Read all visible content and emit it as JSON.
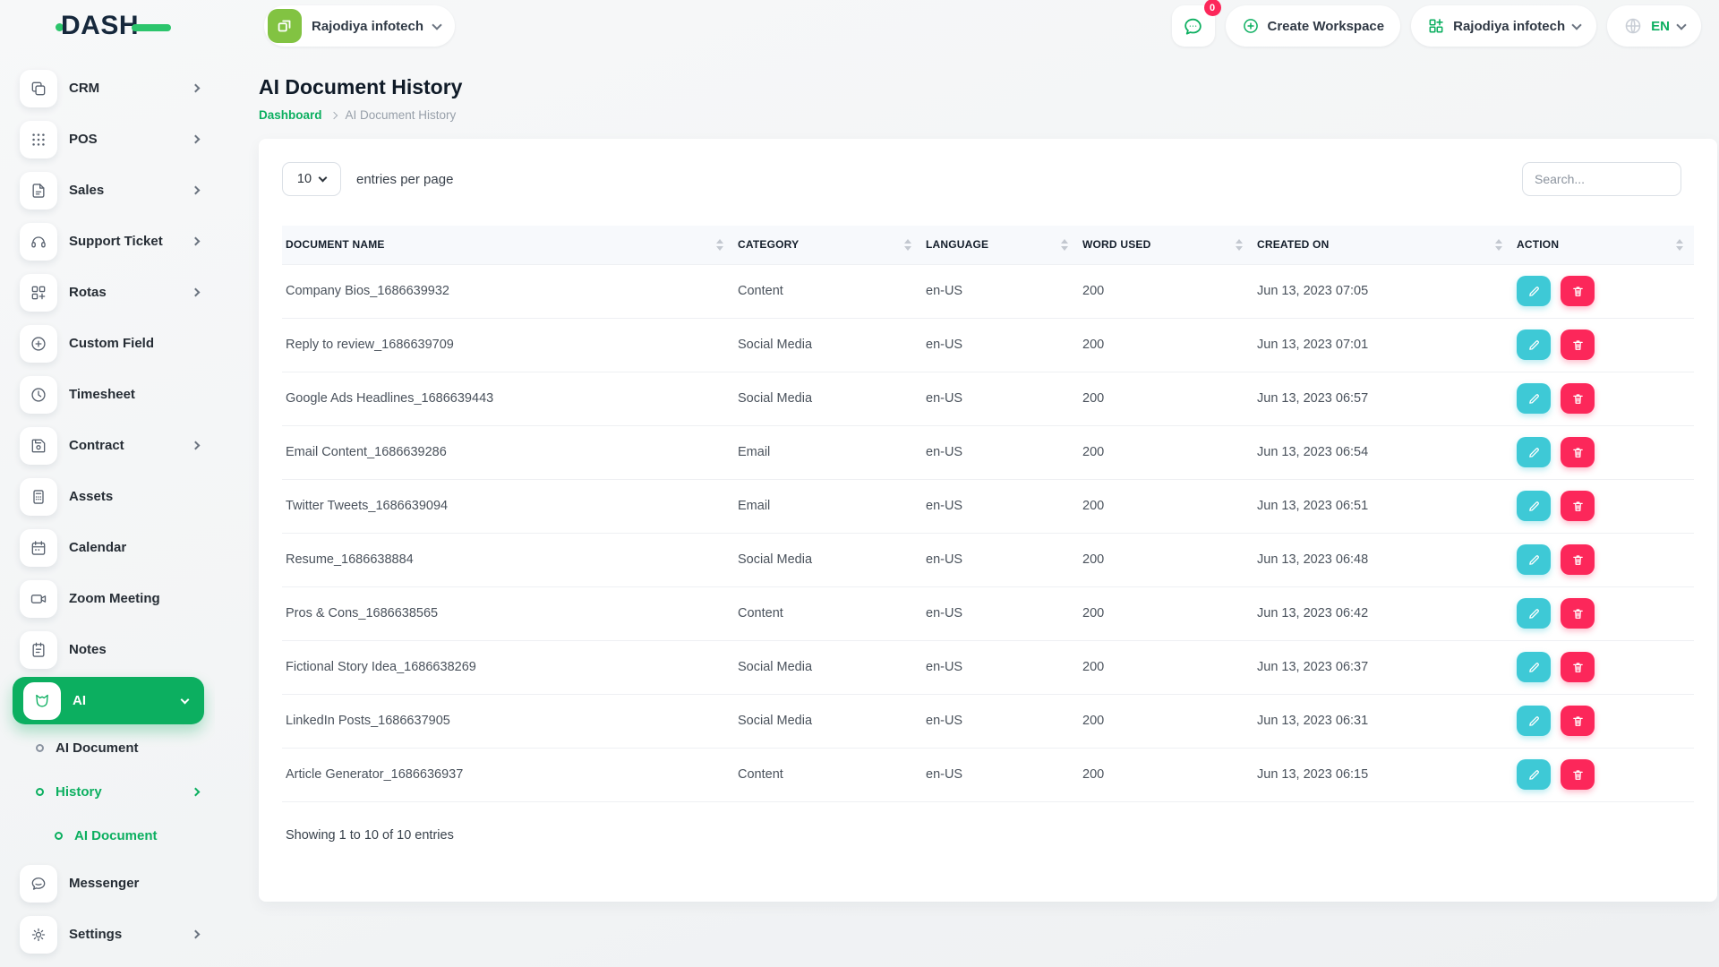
{
  "colors": {
    "green": "#0caf60",
    "logo_green": "#2cc56c",
    "avatar_green": "#82c342",
    "teal": "#3ec9d6",
    "pink": "#fc275a"
  },
  "header": {
    "logo_text": "DASH",
    "workspace_selector": {
      "label": "Rajodiya infotech"
    },
    "notifications": {
      "count": "0"
    },
    "create_workspace": {
      "label": "Create Workspace"
    },
    "account_menu": {
      "label": "Rajodiya infotech"
    },
    "language_menu": {
      "label": "EN"
    }
  },
  "sidebar": {
    "items": [
      {
        "label": "CRM",
        "icon": "crm-icon",
        "chevron": "right",
        "level": 0
      },
      {
        "label": "POS",
        "icon": "pos-icon",
        "chevron": "right",
        "level": 0
      },
      {
        "label": "Sales",
        "icon": "sales-icon",
        "chevron": "right",
        "level": 0
      },
      {
        "label": "Support Ticket",
        "icon": "support-ticket-icon",
        "chevron": "right",
        "level": 0
      },
      {
        "label": "Rotas",
        "icon": "rotas-icon",
        "chevron": "right",
        "level": 0
      },
      {
        "label": "Custom Field",
        "icon": "custom-field-icon",
        "level": 0
      },
      {
        "label": "Timesheet",
        "icon": "timesheet-icon",
        "level": 0
      },
      {
        "label": "Contract",
        "icon": "contract-icon",
        "chevron": "right",
        "level": 0
      },
      {
        "label": "Assets",
        "icon": "assets-icon",
        "level": 0
      },
      {
        "label": "Calendar",
        "icon": "calendar-icon",
        "level": 0
      },
      {
        "label": "Zoom Meeting",
        "icon": "zoom-meeting-icon",
        "level": 0
      },
      {
        "label": "Notes",
        "icon": "notes-icon",
        "level": 0
      },
      {
        "label": "AI",
        "icon": "ai-icon",
        "chevron": "down",
        "level": 0,
        "active": true
      },
      {
        "label": "AI Document",
        "icon": "bullet-icon",
        "level": 1
      },
      {
        "label": "History",
        "icon": "bullet-icon",
        "chevron": "right",
        "level": 1,
        "active": true
      },
      {
        "label": "AI Document",
        "icon": "bullet-icon",
        "level": 2,
        "active": true
      },
      {
        "label": "Messenger",
        "icon": "messenger-icon",
        "level": 0
      },
      {
        "label": "Settings",
        "icon": "settings-icon",
        "chevron": "right",
        "level": 0
      }
    ]
  },
  "page": {
    "title": "AI Document History",
    "breadcrumb": {
      "home": "Dashboard",
      "current": "AI Document History"
    }
  },
  "controls": {
    "entries_value": "10",
    "entries_label": "entries per page",
    "search_placeholder": "Search..."
  },
  "table": {
    "columns": [
      "DOCUMENT NAME",
      "CATEGORY",
      "LANGUAGE",
      "WORD USED",
      "CREATED ON",
      "ACTION"
    ],
    "rows": [
      {
        "document_name": "Company Bios_1686639932",
        "category": "Content",
        "language": "en-US",
        "word_used": "200",
        "created_on": "Jun 13, 2023 07:05"
      },
      {
        "document_name": "Reply to review_1686639709",
        "category": "Social Media",
        "language": "en-US",
        "word_used": "200",
        "created_on": "Jun 13, 2023 07:01"
      },
      {
        "document_name": "Google Ads Headlines_1686639443",
        "category": "Social Media",
        "language": "en-US",
        "word_used": "200",
        "created_on": "Jun 13, 2023 06:57"
      },
      {
        "document_name": "Email Content_1686639286",
        "category": "Email",
        "language": "en-US",
        "word_used": "200",
        "created_on": "Jun 13, 2023 06:54"
      },
      {
        "document_name": "Twitter Tweets_1686639094",
        "category": "Email",
        "language": "en-US",
        "word_used": "200",
        "created_on": "Jun 13, 2023 06:51"
      },
      {
        "document_name": "Resume_1686638884",
        "category": "Social Media",
        "language": "en-US",
        "word_used": "200",
        "created_on": "Jun 13, 2023 06:48"
      },
      {
        "document_name": "Pros & Cons_1686638565",
        "category": "Content",
        "language": "en-US",
        "word_used": "200",
        "created_on": "Jun 13, 2023 06:42"
      },
      {
        "document_name": "Fictional Story Idea_1686638269",
        "category": "Social Media",
        "language": "en-US",
        "word_used": "200",
        "created_on": "Jun 13, 2023 06:37"
      },
      {
        "document_name": "LinkedIn Posts_1686637905",
        "category": "Social Media",
        "language": "en-US",
        "word_used": "200",
        "created_on": "Jun 13, 2023 06:31"
      },
      {
        "document_name": "Article Generator_1686636937",
        "category": "Content",
        "language": "en-US",
        "word_used": "200",
        "created_on": "Jun 13, 2023 06:15"
      }
    ],
    "summary": "Showing 1 to 10 of 10 entries"
  }
}
